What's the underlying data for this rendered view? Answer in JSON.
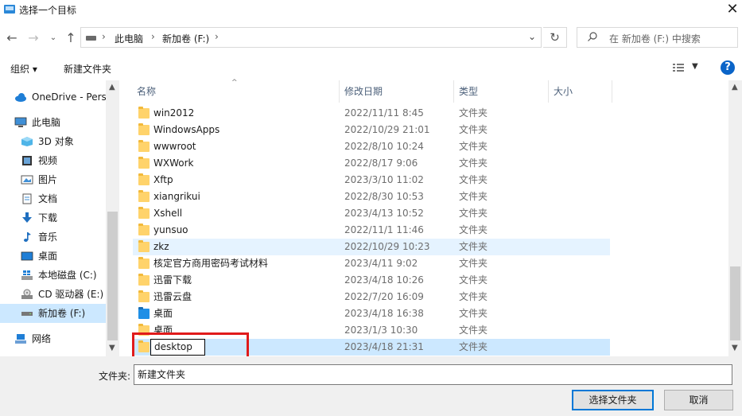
{
  "window": {
    "title": "选择一个目标"
  },
  "address": {
    "computer": "此电脑",
    "drive": "新加卷 (F:)",
    "search_placeholder": "在 新加卷 (F:) 中搜索"
  },
  "toolbar": {
    "organize": "组织 ▾",
    "new_folder": "新建文件夹"
  },
  "nav": {
    "items": [
      {
        "label": "OneDrive - Personal"
      },
      {
        "label": "此电脑"
      },
      {
        "label": "3D 对象"
      },
      {
        "label": "视频"
      },
      {
        "label": "图片"
      },
      {
        "label": "文档"
      },
      {
        "label": "下载"
      },
      {
        "label": "音乐"
      },
      {
        "label": "桌面"
      },
      {
        "label": "本地磁盘 (C:)"
      },
      {
        "label": "CD 驱动器 (E:)"
      },
      {
        "label": "新加卷 (F:)"
      },
      {
        "label": "网络"
      }
    ]
  },
  "columns": {
    "name": "名称",
    "date": "修改日期",
    "type": "类型",
    "size": "大小"
  },
  "rows": [
    {
      "name": "win2012",
      "date": "2022/11/11 8:45",
      "type": "文件夹"
    },
    {
      "name": "WindowsApps",
      "date": "2022/10/29 21:01",
      "type": "文件夹"
    },
    {
      "name": "wwwroot",
      "date": "2022/8/10 10:24",
      "type": "文件夹"
    },
    {
      "name": "WXWork",
      "date": "2022/8/17 9:06",
      "type": "文件夹"
    },
    {
      "name": "Xftp",
      "date": "2023/3/10 11:02",
      "type": "文件夹"
    },
    {
      "name": "xiangrikui",
      "date": "2022/8/30 10:53",
      "type": "文件夹"
    },
    {
      "name": "Xshell",
      "date": "2023/4/13 10:52",
      "type": "文件夹"
    },
    {
      "name": "yunsuo",
      "date": "2022/11/1 11:46",
      "type": "文件夹"
    },
    {
      "name": "zkz",
      "date": "2022/10/29 10:23",
      "type": "文件夹"
    },
    {
      "name": "核定官方商用密码考试材料",
      "date": "2023/4/11 9:02",
      "type": "文件夹"
    },
    {
      "name": "迅雷下载",
      "date": "2023/4/18 10:26",
      "type": "文件夹"
    },
    {
      "name": "迅雷云盘",
      "date": "2022/7/20 16:09",
      "type": "文件夹"
    },
    {
      "name": "桌面",
      "date": "2023/4/18 16:38",
      "type": "文件夹"
    },
    {
      "name": "桌面",
      "date": "2023/1/3 10:30",
      "type": "文件夹"
    },
    {
      "name": "desktop",
      "date": "2023/4/18 21:31",
      "type": "文件夹"
    }
  ],
  "footer": {
    "filename_label": "文件夹:",
    "filename_value": "新建文件夹",
    "select_button": "选择文件夹",
    "cancel_button": "取消"
  },
  "colors": {
    "selected": "#cce8ff",
    "hover": "#e5f3ff",
    "highlight_box": "#e01b1b",
    "help": "#0a64c8"
  }
}
